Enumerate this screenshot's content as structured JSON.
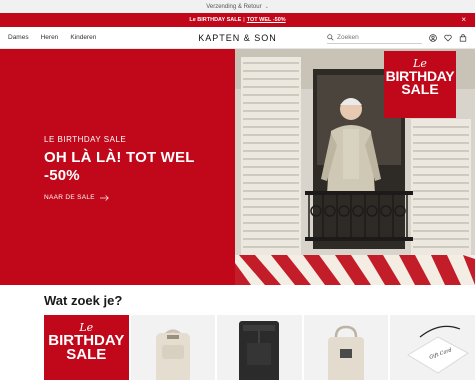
{
  "topbar": {
    "label": "Verzending & Retour"
  },
  "promo": {
    "text": "Le BIRTHDAY SALE",
    "separator": "|",
    "link": "TOT WEL -50%"
  },
  "nav": {
    "links": [
      "Dames",
      "Heren",
      "Kinderen"
    ],
    "logo": "KAPTEN & SON",
    "search_placeholder": "Zoeken"
  },
  "hero": {
    "kicker": "LE BIRTHDAY SALE",
    "headline_line1": "OH LÀ LÀ! TOT WEL",
    "headline_line2": "-50%",
    "cta": "NAAR DE SALE",
    "badge": {
      "le": "Le",
      "line1": "BIRTHDAY",
      "line2": "SALE"
    }
  },
  "section": {
    "title": "Wat zoek je?"
  },
  "categories": [
    {
      "type": "sale-badge",
      "le": "Le",
      "line1": "BIRTHDAY",
      "line2": "SALE"
    },
    {
      "type": "image",
      "icon": "beige-backpack-icon"
    },
    {
      "type": "image",
      "icon": "black-backpack-icon"
    },
    {
      "type": "image",
      "icon": "beige-bag-icon"
    },
    {
      "type": "image",
      "icon": "gift-card-icon",
      "text": "Gift Card"
    }
  ],
  "colors": {
    "brand_red": "#c0081a",
    "topbar_gray": "#f1f1f1"
  }
}
